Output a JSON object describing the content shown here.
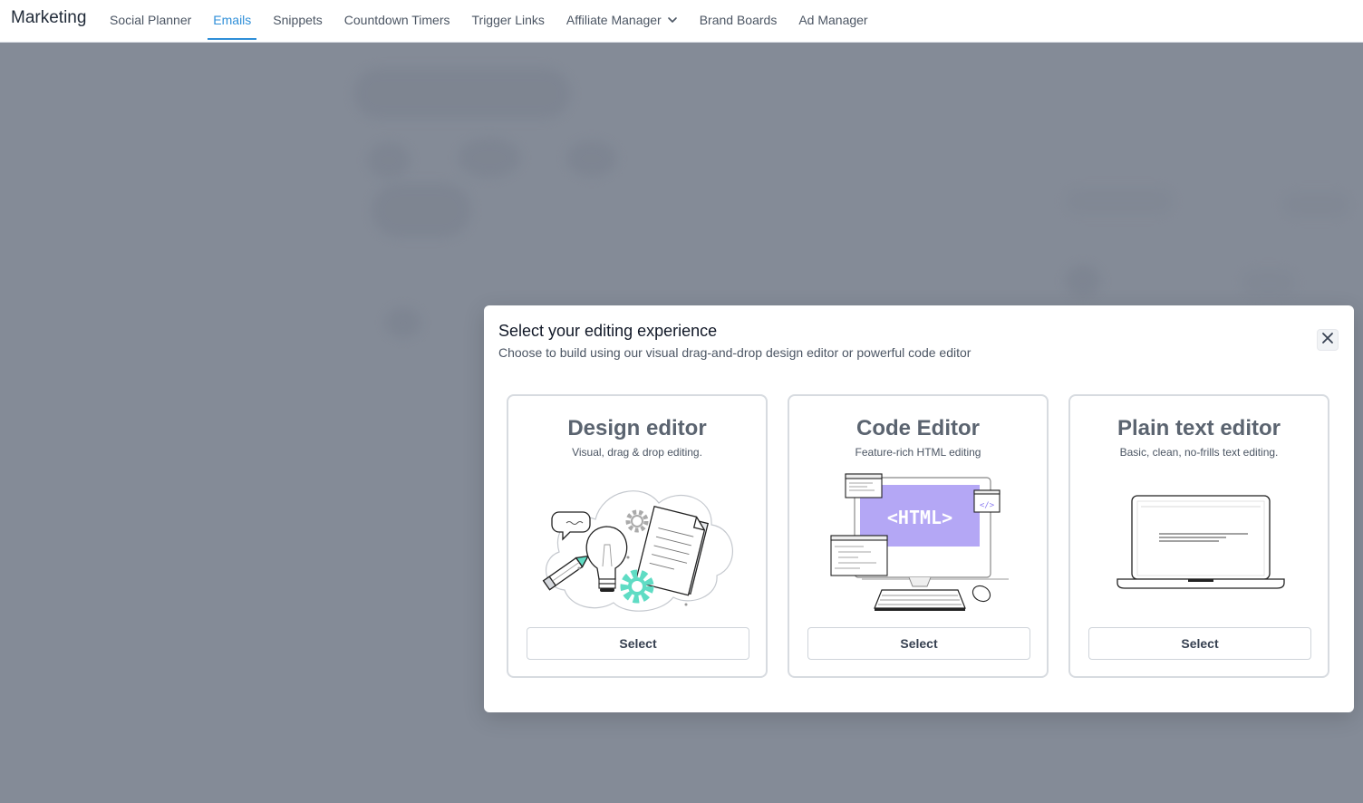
{
  "app": {
    "title": "Marketing"
  },
  "nav": {
    "items": [
      {
        "label": "Social Planner"
      },
      {
        "label": "Emails"
      },
      {
        "label": "Snippets"
      },
      {
        "label": "Countdown Timers"
      },
      {
        "label": "Trigger Links"
      },
      {
        "label": "Affiliate Manager"
      },
      {
        "label": "Brand Boards"
      },
      {
        "label": "Ad Manager"
      }
    ],
    "active": "Emails",
    "accent_color": "#2f8fd8"
  },
  "modal": {
    "title": "Select your editing experience",
    "subtitle": "Choose to build using our visual drag-and-drop design editor or powerful code editor",
    "close_icon": "close-icon",
    "cards": [
      {
        "title": "Design editor",
        "description": "Visual, drag & drop editing.",
        "button": "Select",
        "illustration": "design-illustration"
      },
      {
        "title": "Code Editor",
        "description": "Feature-rich HTML editing",
        "button": "Select",
        "illustration": "code-illustration",
        "screen_text": "<HTML>",
        "tag_text": "</>"
      },
      {
        "title": "Plain text editor",
        "description": "Basic, clean, no-frills text editing.",
        "button": "Select",
        "illustration": "laptop-illustration"
      }
    ]
  },
  "colors": {
    "backdrop": "#848b97",
    "html_screen": "#b4a7f5",
    "gear_teal": "#5fdcc4"
  }
}
